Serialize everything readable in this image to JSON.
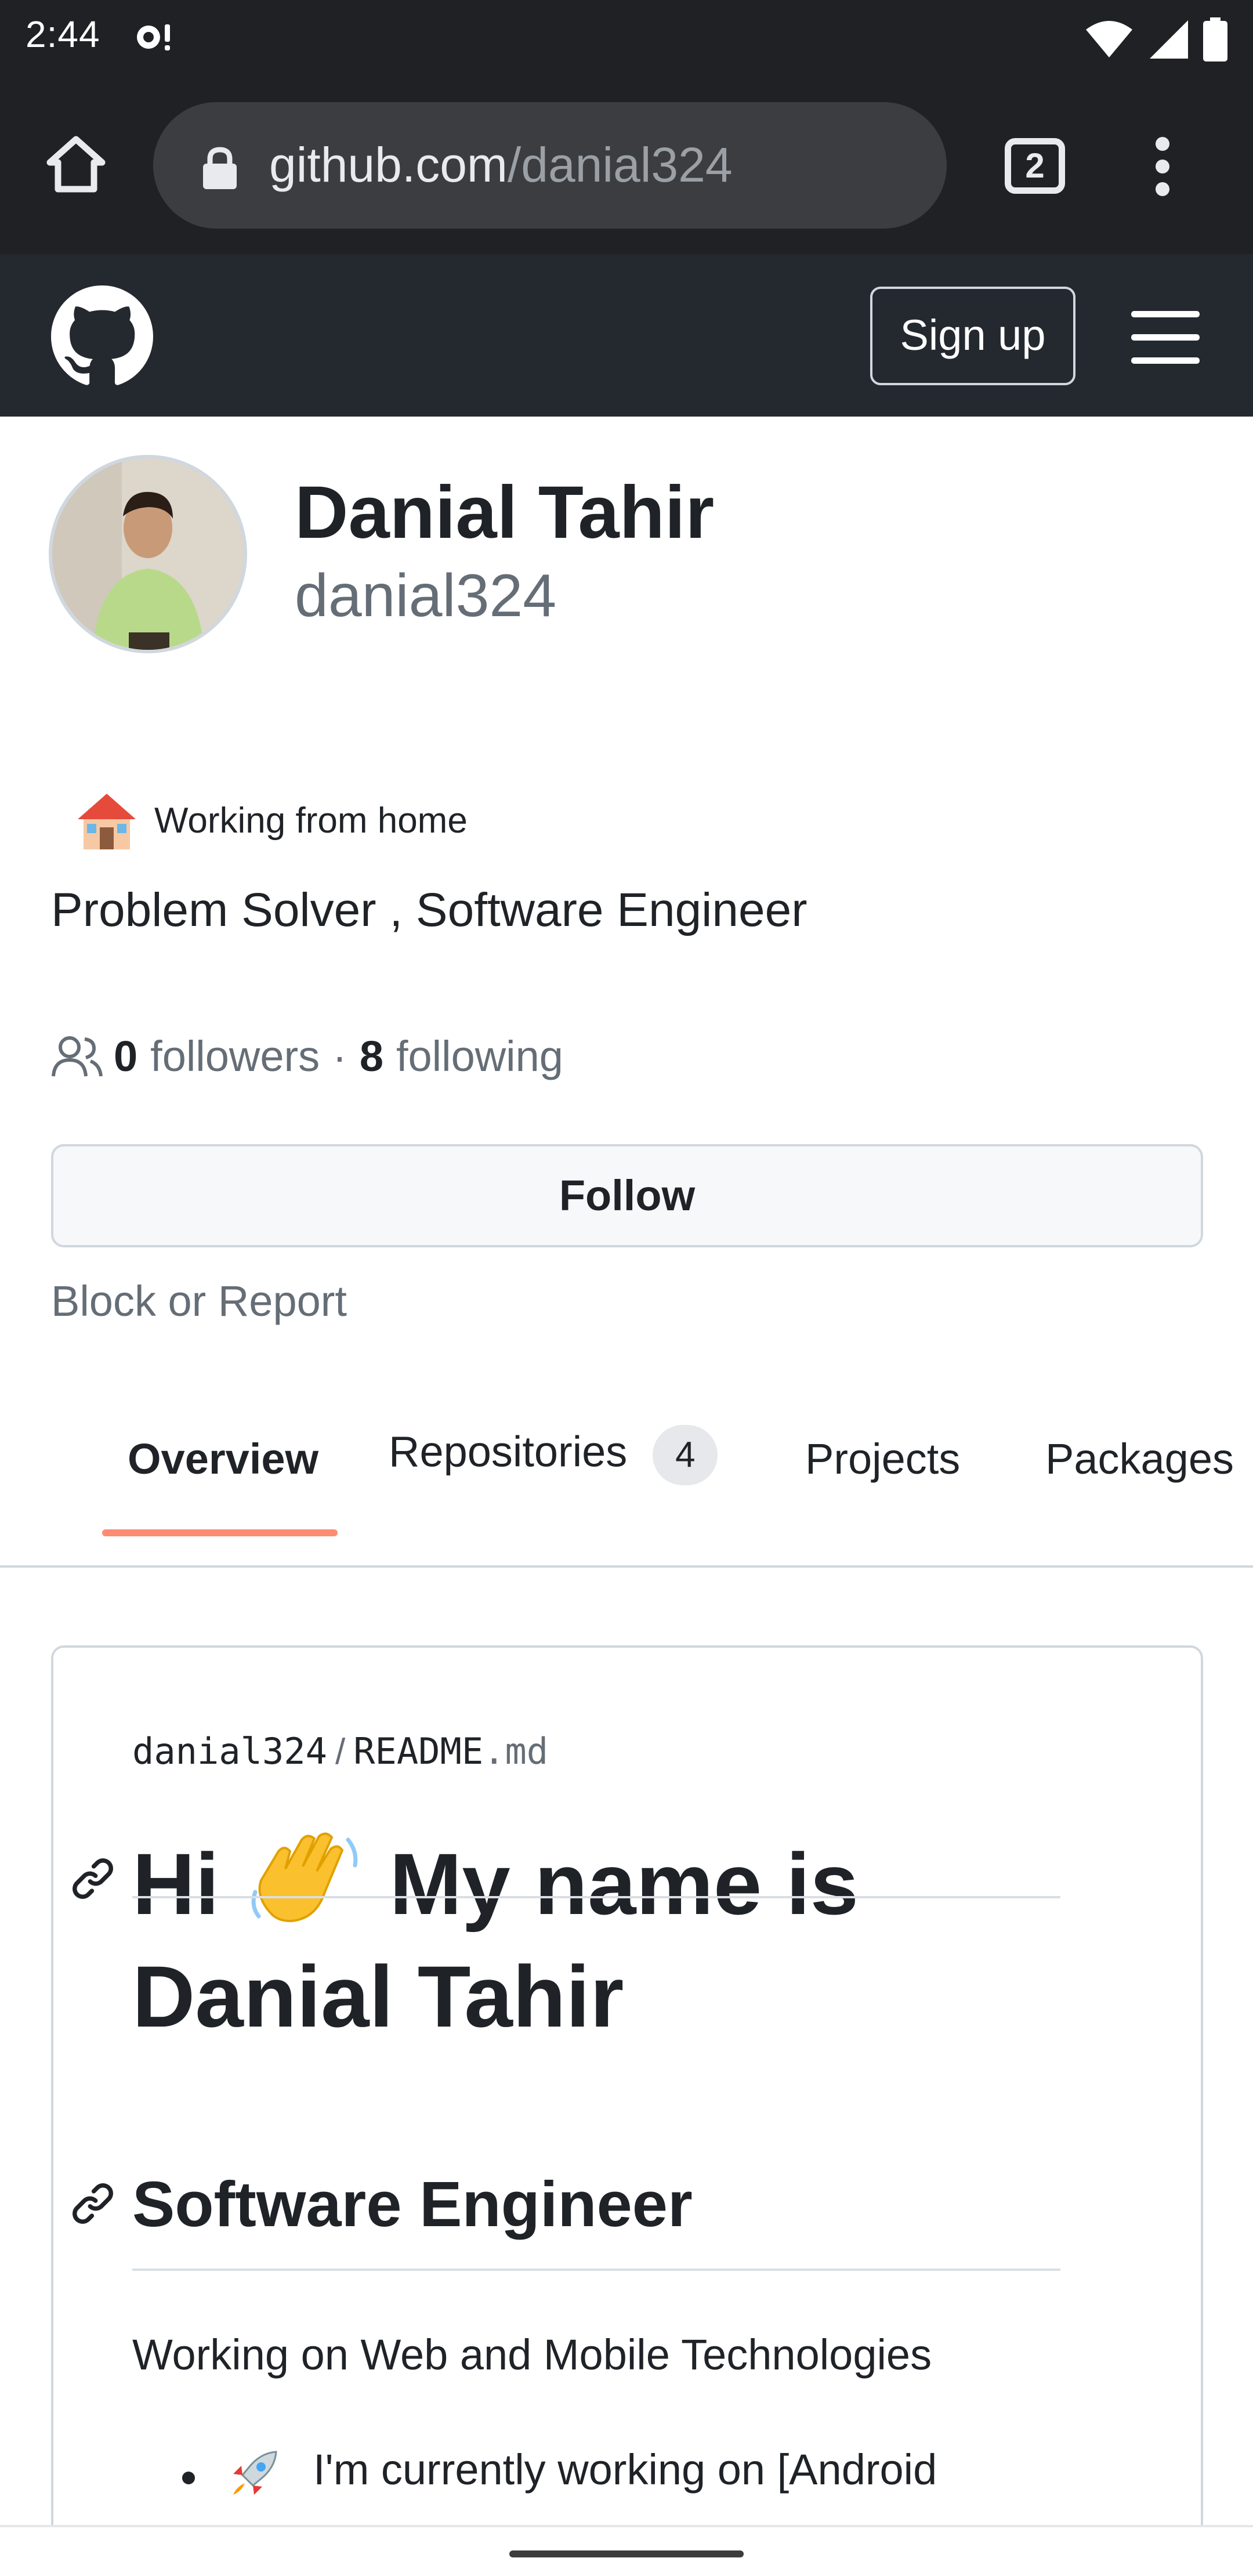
{
  "status_bar": {
    "time": "2:44",
    "icons": [
      "alert-icon",
      "wifi-icon",
      "signal-icon",
      "battery-icon"
    ]
  },
  "browser": {
    "url_host": "github.com",
    "url_path": "/danial324",
    "tab_count": "2",
    "icons": [
      "home-icon",
      "lock-icon",
      "tab-switcher-icon",
      "more-vert-icon"
    ]
  },
  "header": {
    "logo": "github-mark-icon",
    "signup_label": "Sign up",
    "menu_icon": "hamburger-icon"
  },
  "profile": {
    "name": "Danial Tahir",
    "username": "danial324",
    "status_text": "Working from home",
    "status_emoji": "house-emoji",
    "bio": "Problem Solver , Software Engineer",
    "followers_count": "0",
    "followers_label": "followers",
    "separator": "·",
    "following_count": "8",
    "following_label": "following",
    "follow_button": "Follow",
    "block_report": "Block or Report"
  },
  "tabs": {
    "overview": "Overview",
    "repositories": "Repositories",
    "repositories_count": "4",
    "projects": "Projects",
    "packages": "Packages",
    "active": "Overview"
  },
  "readme": {
    "owner": "danial324",
    "path_sep": "/",
    "file_name": "README",
    "file_ext": ".md",
    "heading_part1": "Hi",
    "heading_part2": "My name is Danial Tahir",
    "subheading": "Software Engineer",
    "paragraph": "Working on Web and Mobile Technologies",
    "list_item": "I'm currently working on [Android"
  },
  "colors": {
    "chrome_bg": "#202124",
    "github_header_bg": "#24292f",
    "tab_underline": "#fd8c73",
    "muted_text": "#656d76",
    "border": "#d0d7de"
  }
}
